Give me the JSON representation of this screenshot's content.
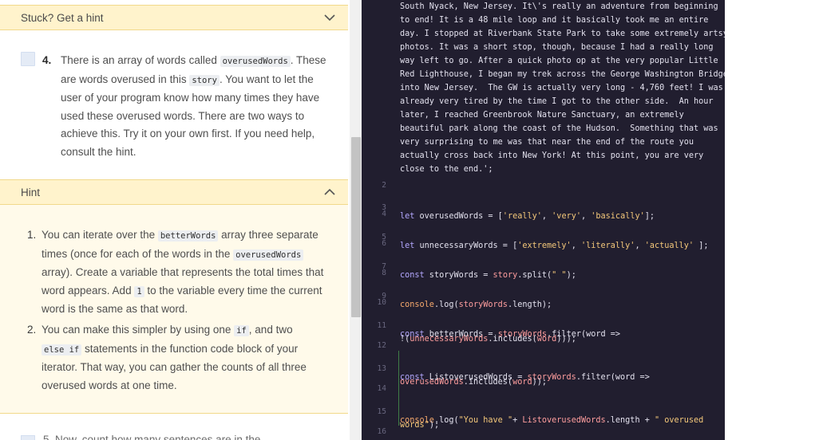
{
  "left_panel": {
    "hint_bar_1": {
      "label": "Stuck? Get a hint"
    },
    "task4": {
      "number": "4.",
      "text_1": "There is an array of words called ",
      "code_1": "overusedWords",
      "text_2": ". These are words overused in this ",
      "code_2": "story",
      "text_3": ". You want to let the user of your program know how many times they have used these overused words. There are two ways to achieve this. Try it on your own first. If you need help, consult the hint."
    },
    "hint_bar_2": {
      "label": "Hint"
    },
    "hint_items": [
      {
        "n": "1.",
        "t1": "You can iterate over the ",
        "c1": "betterWords",
        "t2": " array three separate times (once for each of the words in the ",
        "c2": "overusedWords",
        "t3": " array). Create a variable that represents the total times that word appears. Add ",
        "c3": "1",
        "t4": " to the variable every time the current word is the same as that word."
      },
      {
        "n": "2.",
        "t1": "You can make this simpler by using one ",
        "c1": "if",
        "t2": ", and two ",
        "c2": "else if",
        "t3": " statements in the function code block of your iterator. That way, you can gather the counts of all three overused words at one time."
      }
    ],
    "next_task_clip": "5. Now, count how many sentences are in the"
  },
  "editor": {
    "story_lines": [
      "South Nyack, New Jersey. It\\'s really an adventure from beginning",
      "to end! It is a 48 mile loop and it basically took me an entire",
      "day. I stopped at Riverbank State Park to take some extremely artsy",
      "photos. It was a short stop, though, because I had a really long",
      "way left to go. After a quick photo op at the very popular Little",
      "Red Lighthouse, I began my trek across the George Washington Bridge",
      "into New Jersey.  The GW is actually very long - 4,760 feet! I was",
      "already very tired by the time I got to the other side.  An hour",
      "later, I reached Greenbrook Nature Sanctuary, an extremely",
      "beautiful park along the coast of the Hudson.  Something that was",
      "very surprising to me was that near the end of the route you",
      "actually cross back into New York! At this point, you are very",
      "close to the end.';"
    ],
    "line_numbers": [
      "2",
      "3",
      "4",
      "5",
      "6",
      "7",
      "8",
      "9",
      "10",
      "11",
      "12",
      "13",
      "14",
      "15",
      "16"
    ],
    "line3": {
      "kw": "let",
      "name": " overusedWords = [",
      "s1": "'really'",
      "c1": ", ",
      "s2": "'very'",
      "c2": ", ",
      "s3": "'basically'",
      "end": "];"
    },
    "line5": {
      "kw": "let",
      "name": " unnecessaryWords = [",
      "s1": "'extremely'",
      "c1": ", ",
      "s2": "'literally'",
      "c2": ", ",
      "s3": "'actually'",
      "end": " ];"
    },
    "line7": {
      "kw": "const",
      "name": " storyWords = ",
      "obj": "story",
      "m": ".split(",
      "s": "\" \"",
      "end": ");"
    },
    "line9": {
      "fn": "console",
      "m": ".log(",
      "obj": "storyWords",
      "end": ".length);"
    },
    "line11a": {
      "kw": "const",
      "name": " betterWords = ",
      "obj": "storyWords",
      "m": ".filter(word =>"
    },
    "line11b": {
      "p": "!(",
      "obj": "unnecessaryWords",
      "m": ".includes(",
      "arg": "word",
      "end": ")));"
    },
    "line13a": {
      "kw": "const",
      "name": " ListoverusedWords = ",
      "obj": "storyWords",
      "m": ".filter(word =>"
    },
    "line13b": {
      "obj": "overusedWords",
      "m": ".includes(",
      "arg": "word",
      "end": "));"
    },
    "line15a": {
      "fn": "console",
      "m": ".log(",
      "s1": "\"You have \"",
      "plus": "+ ",
      "obj": "ListoverusedWords",
      "m2": ".length + ",
      "s2": "\" overused"
    },
    "line15b": {
      "s": "words\"",
      "end": ");"
    }
  }
}
